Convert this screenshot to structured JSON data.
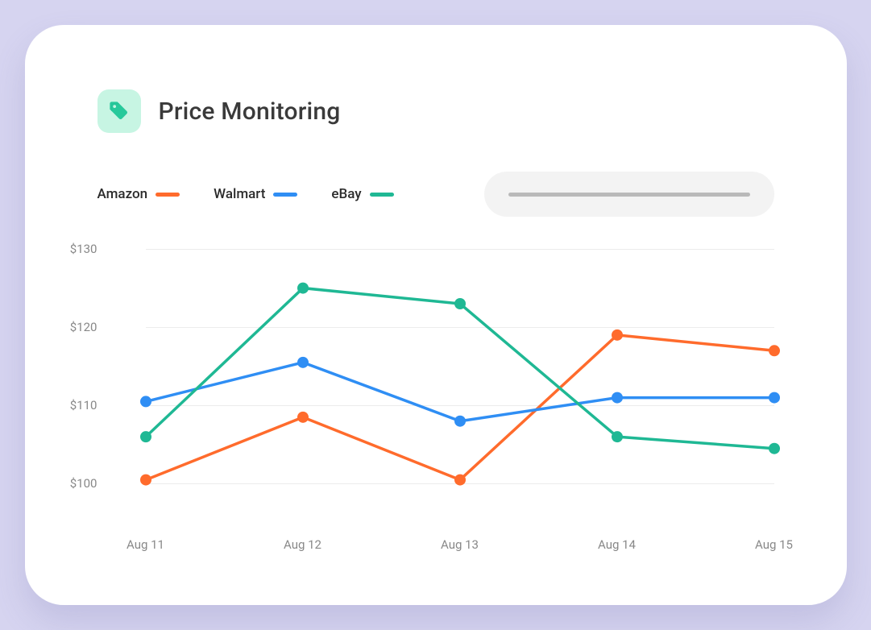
{
  "header": {
    "title": "Price Monitoring",
    "icon": "price-tag-icon"
  },
  "legend": [
    {
      "name": "Amazon",
      "color": "#ff6b2c"
    },
    {
      "name": "Walmart",
      "color": "#2f8ef4"
    },
    {
      "name": "eBay",
      "color": "#1fb894"
    }
  ],
  "y_ticks": [
    "$130",
    "$120",
    "$110",
    "$100"
  ],
  "x_ticks": [
    "Aug 11",
    "Aug 12",
    "Aug 13",
    "Aug 14",
    "Aug 15"
  ],
  "chart_data": {
    "type": "line",
    "title": "Price Monitoring",
    "xlabel": "",
    "ylabel": "",
    "ylim": [
      95,
      130
    ],
    "categories": [
      "Aug 11",
      "Aug 12",
      "Aug 13",
      "Aug 14",
      "Aug 15"
    ],
    "series": [
      {
        "name": "Amazon",
        "color": "#ff6b2c",
        "values": [
          100.5,
          108.5,
          100.5,
          119,
          117
        ]
      },
      {
        "name": "Walmart",
        "color": "#2f8ef4",
        "values": [
          110.5,
          115.5,
          108,
          111,
          111
        ]
      },
      {
        "name": "eBay",
        "color": "#1fb894",
        "values": [
          106,
          125,
          123,
          106,
          104.5
        ]
      }
    ]
  }
}
